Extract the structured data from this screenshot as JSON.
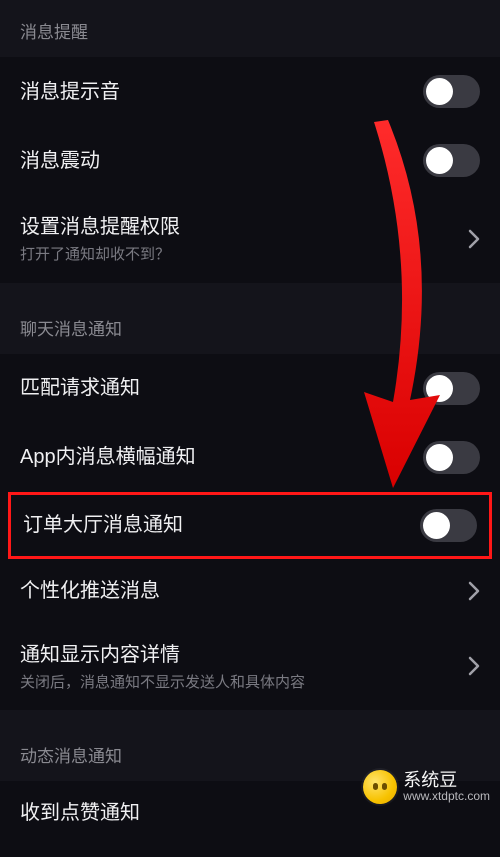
{
  "sections": {
    "message_alert": {
      "header": "消息提醒",
      "sound": {
        "title": "消息提示音"
      },
      "vibrate": {
        "title": "消息震动"
      },
      "permission": {
        "title": "设置消息提醒权限",
        "sub": "打开了通知却收不到？"
      }
    },
    "chat_notify": {
      "header": "聊天消息通知",
      "match_request": {
        "title": "匹配请求通知"
      },
      "in_app_banner": {
        "title": "App内消息横幅通知"
      },
      "order_hall": {
        "title": "订单大厅消息通知"
      },
      "personalized_push": {
        "title": "个性化推送消息"
      },
      "show_detail": {
        "title": "通知显示内容详情",
        "sub": "关闭后，消息通知不显示发送人和具体内容"
      }
    },
    "activity_notify": {
      "header": "动态消息通知",
      "like_received": {
        "title": "收到点赞通知"
      }
    }
  },
  "watermark": {
    "name": "系统豆",
    "url": "www.xtdptc.com"
  }
}
